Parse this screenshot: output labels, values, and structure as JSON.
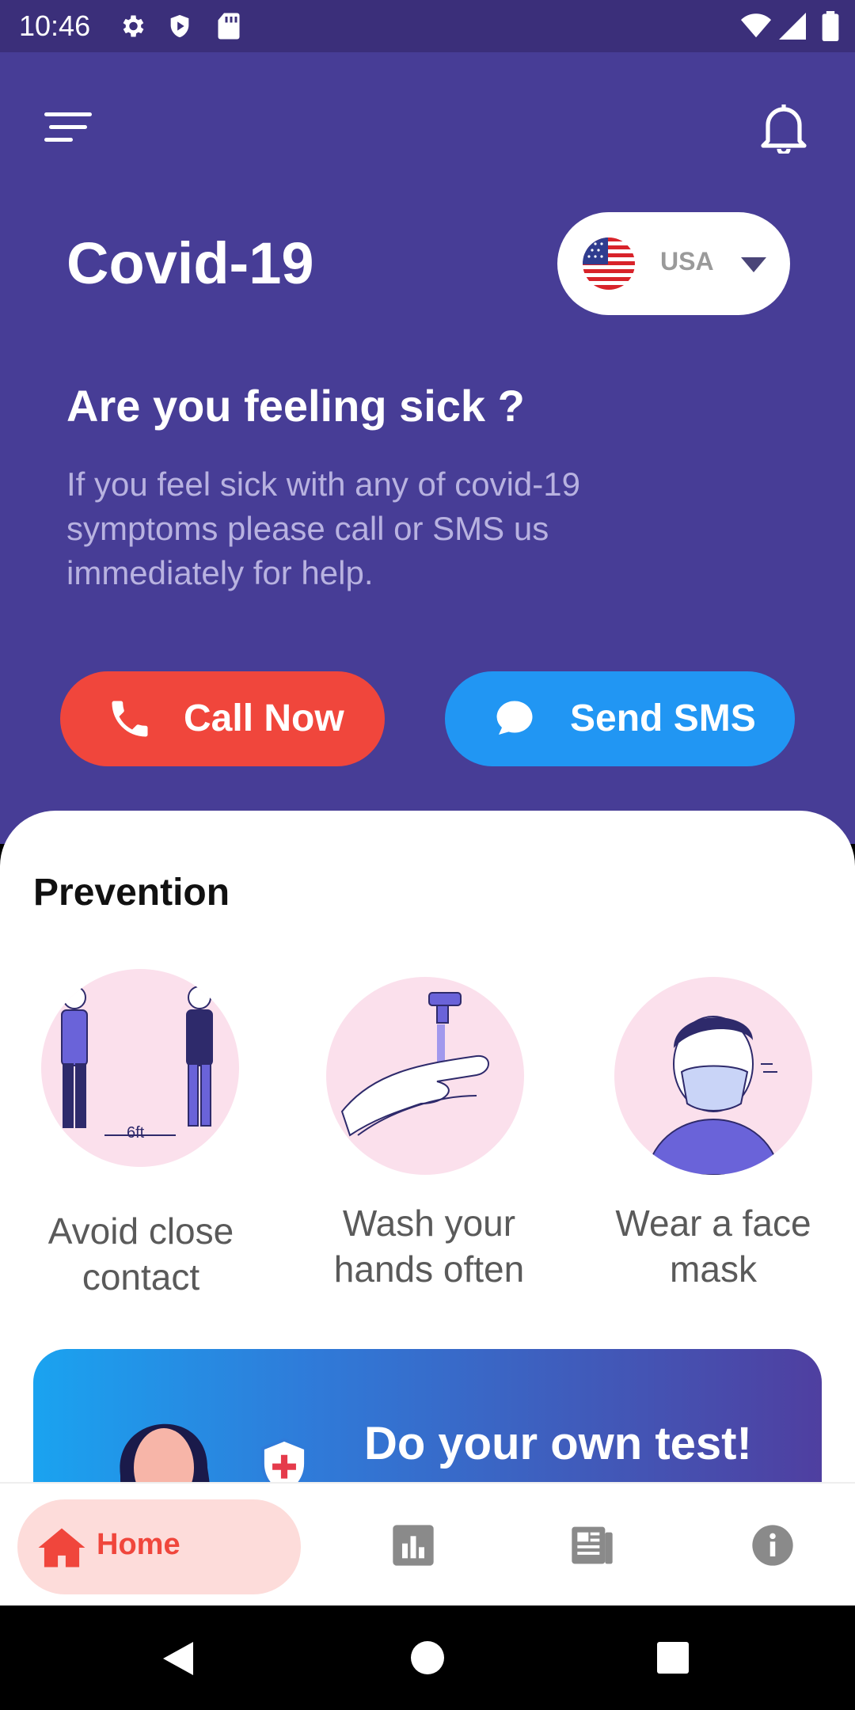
{
  "status_bar": {
    "time": "10:46"
  },
  "header": {
    "title": "Covid-19"
  },
  "country_selector": {
    "label": "USA"
  },
  "hero": {
    "question": "Are you feeling sick ?",
    "description": "If you feel sick with any of covid-19 symptoms please call or SMS us immediately for help.",
    "call_label": "Call Now",
    "sms_label": "Send SMS"
  },
  "prevention": {
    "title": "Prevention",
    "items": [
      {
        "label_line1": "Avoid close",
        "label_line2": "contact",
        "distance_text": "6ft"
      },
      {
        "label_line1": "Wash your",
        "label_line2": "hands often"
      },
      {
        "label_line1": "Wear a face",
        "label_line2": "mask"
      }
    ]
  },
  "promo": {
    "title": "Do your own test!"
  },
  "bottom_nav": {
    "items": [
      {
        "label": "Home",
        "icon": "home-icon",
        "active": true
      },
      {
        "icon": "stats-icon"
      },
      {
        "icon": "news-icon"
      },
      {
        "icon": "info-icon"
      }
    ]
  },
  "colors": {
    "hero_bg": "#473d96",
    "call_button": "#f0463c",
    "sms_button": "#2196f3",
    "home_pill": "#fddcda",
    "accent_red": "#f0463c",
    "prevention_circle": "#fbe0ec"
  }
}
